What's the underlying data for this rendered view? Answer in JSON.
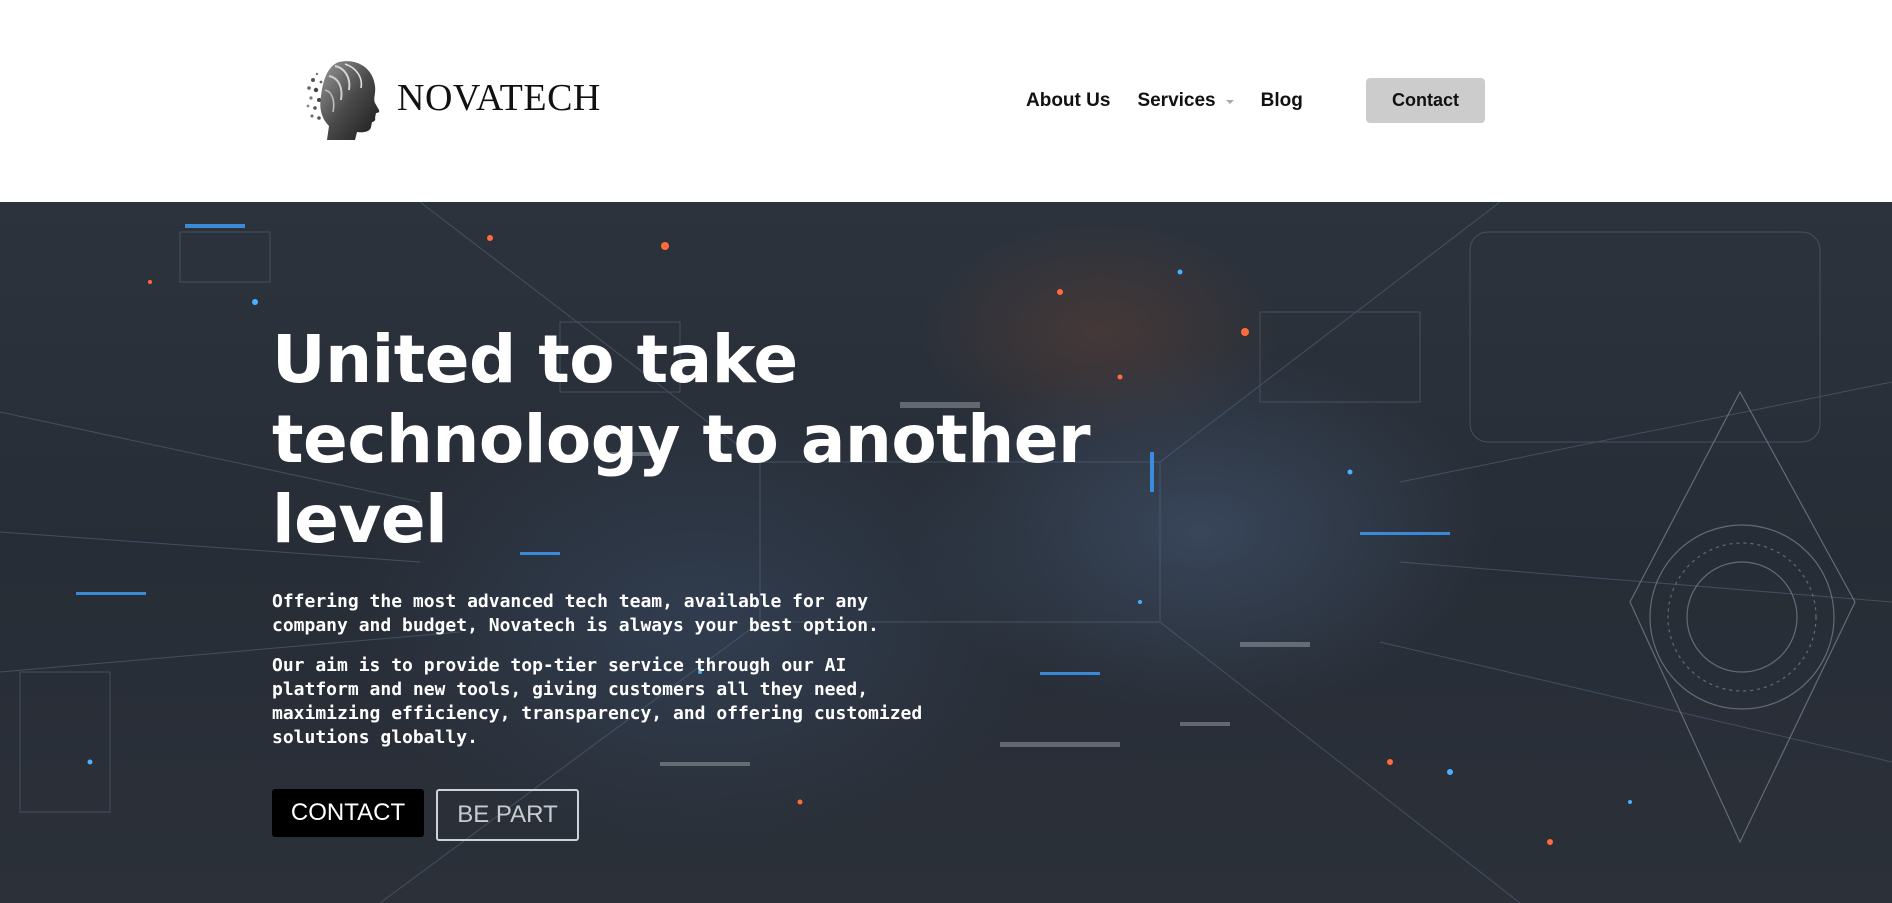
{
  "brand": {
    "name": "NOVATECH",
    "logo_icon": "tech-head-profile-icon"
  },
  "nav": {
    "items": [
      {
        "label": "About Us"
      },
      {
        "label": "Services",
        "has_dropdown": true
      },
      {
        "label": "Blog"
      }
    ],
    "contact_label": "Contact"
  },
  "hero": {
    "title": "United to take technology to another level",
    "paragraph_1": "Offering the most advanced tech team, available for any company and budget, Novatech is always your best option.",
    "paragraph_2": "Our aim is to provide top-tier service through our AI platform and new tools, giving customers all they need, maximizing efficiency, transparency, and offering customized solutions globally.",
    "primary_button": "CONTACT",
    "secondary_button": "BE PART",
    "background": "futuristic-digital-city-tunnel"
  },
  "colors": {
    "header_bg": "#ffffff",
    "contact_button_bg": "#cccccc",
    "hero_bg": "#2b313a",
    "primary_button_bg": "#000000",
    "text_light": "#ffffff"
  }
}
